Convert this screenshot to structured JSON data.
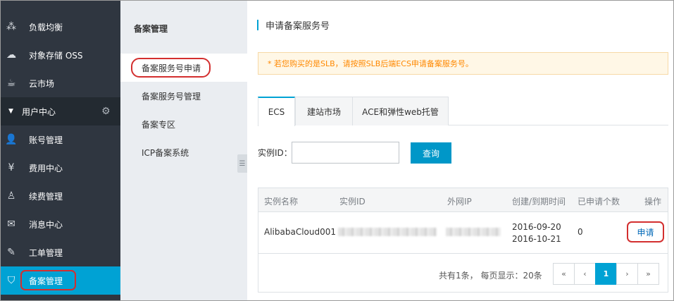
{
  "sidebar": {
    "items": [
      {
        "icon": "load-balance-icon",
        "glyph": "⁂",
        "label": "负载均衡"
      },
      {
        "icon": "cloud-storage-icon",
        "glyph": "☁",
        "label": "对象存储 OSS"
      },
      {
        "icon": "cloud-market-icon",
        "glyph": "☕",
        "label": "云市场"
      }
    ],
    "section": {
      "caret": "▼",
      "label": "用户中心",
      "gear": "⚙"
    },
    "user_items": [
      {
        "icon": "user-icon",
        "glyph": "👤",
        "label": "账号管理"
      },
      {
        "icon": "yen-icon",
        "glyph": "¥",
        "label": "费用中心"
      },
      {
        "icon": "renew-icon",
        "glyph": "♙",
        "label": "续费管理"
      },
      {
        "icon": "mail-icon",
        "glyph": "✉",
        "label": "消息中心"
      },
      {
        "icon": "pen-icon",
        "glyph": "✎",
        "label": "工单管理"
      },
      {
        "icon": "shield-icon",
        "glyph": "⛉",
        "label": "备案管理"
      }
    ]
  },
  "submenu": {
    "title": "备案管理",
    "items": [
      "备案服务号申请",
      "备案服务号管理",
      "备案专区",
      "ICP备案系统"
    ],
    "collapse_glyph": "☰"
  },
  "main": {
    "title": "申请备案服务号",
    "notice": "* 若您购买的是SLB，请按照SLB后端ECS申请备案服务号。",
    "tabs": [
      "ECS",
      "建站市场",
      "ACE和弹性web托管"
    ],
    "search": {
      "label": "实例ID：",
      "value": "",
      "button": "查询"
    },
    "table": {
      "headers": [
        "实例名称",
        "实例ID",
        "外网IP",
        "创建/到期时间",
        "已申请个数",
        "操作"
      ],
      "rows": [
        {
          "name": "AlibabaCloud001",
          "created": "2016-09-20",
          "expires": "2016-10-21",
          "count": "0",
          "action": "申请"
        }
      ]
    },
    "pager": {
      "info": "共有1条， 每页显示：20条",
      "buttons": [
        "«",
        "‹",
        "1",
        "›",
        "»"
      ],
      "current": "1"
    }
  },
  "colors": {
    "accent": "#00a2d4",
    "sidebar": "#2f3640",
    "highlight": "#d32f2f",
    "notice_text": "#ff8800"
  }
}
